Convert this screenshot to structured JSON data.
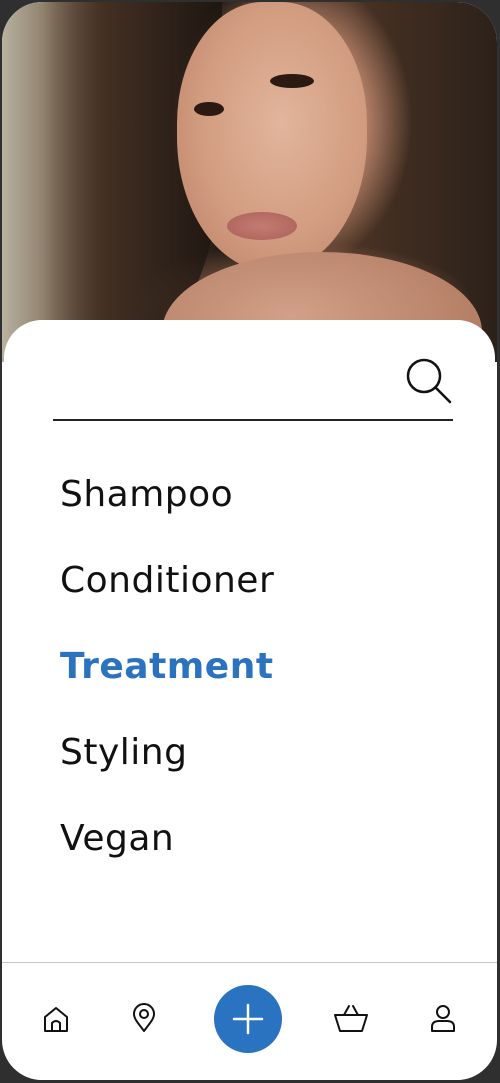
{
  "colors": {
    "accent": "#2b72bf",
    "text": "#111111",
    "background": "#ffffff"
  },
  "search": {
    "icon": "search-icon"
  },
  "categories": {
    "items": [
      {
        "label": "Shampoo",
        "active": false
      },
      {
        "label": "Conditioner",
        "active": false
      },
      {
        "label": "Treatment",
        "active": true
      },
      {
        "label": "Styling",
        "active": false
      },
      {
        "label": "Vegan",
        "active": false
      }
    ]
  },
  "nav": {
    "items": [
      {
        "icon": "home-icon"
      },
      {
        "icon": "location-pin-icon"
      },
      {
        "icon": "plus-icon"
      },
      {
        "icon": "shopping-basket-icon"
      },
      {
        "icon": "user-icon"
      }
    ]
  }
}
